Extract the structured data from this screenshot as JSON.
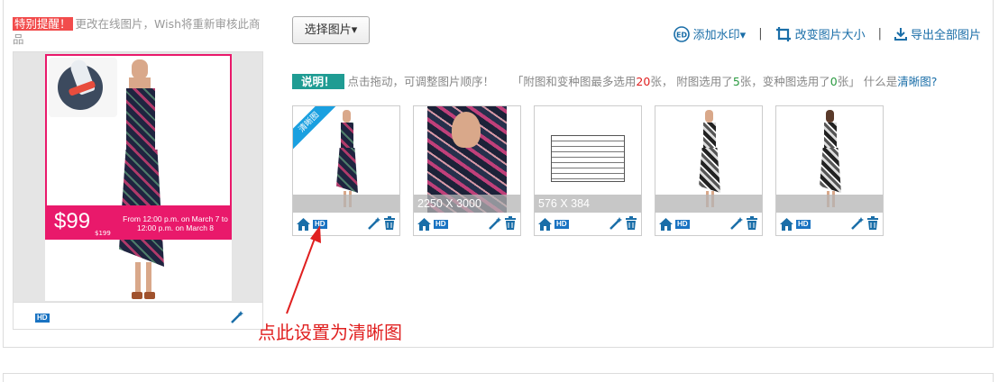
{
  "notice": {
    "tag": "特别提醒！",
    "text": "更改在线图片，Wish将重新审核此商品"
  },
  "main_image": {
    "price": "$99",
    "old_price": "$199",
    "promo": "From 12:00 p.m. on March 7 to 12:00 p.m. on March 8",
    "hd_label": "HD"
  },
  "toolbar": {
    "select_label": "选择图片▾",
    "watermark_label": "添加水印▾",
    "resize_label": "改变图片大小",
    "export_label": "导出全部图片",
    "separator": "|"
  },
  "info": {
    "tag": "说明！",
    "drag_text": "点击拖动，可调整图片顺序！",
    "limits_text_1": "「附图和变种图最多选用",
    "max_count": "20",
    "limits_text_2": "张， 附图选用了",
    "extra_count": "5",
    "limits_text_3": "张，变种图选用了",
    "variant_count": "0",
    "limits_text_4": "张」 什么是",
    "clear_link": "清晰图",
    "question": "?"
  },
  "thumbnails": [
    {
      "ribbon": "清晰图",
      "size": "",
      "hd": "HD"
    },
    {
      "ribbon": "",
      "size": "2250 X 3000",
      "hd": "HD"
    },
    {
      "ribbon": "",
      "size": "576 X 384",
      "hd": "HD"
    },
    {
      "ribbon": "",
      "size": "",
      "hd": "HD"
    },
    {
      "ribbon": "",
      "size": "",
      "hd": "HD"
    }
  ],
  "annotation": "点此设置为清晰图",
  "colors": {
    "accent": "#1a6ea8",
    "notice_red": "#f24c4c",
    "info_teal": "#1f9c93",
    "ribbon_blue": "#1aa0e0",
    "annotation_red": "#e02020"
  }
}
